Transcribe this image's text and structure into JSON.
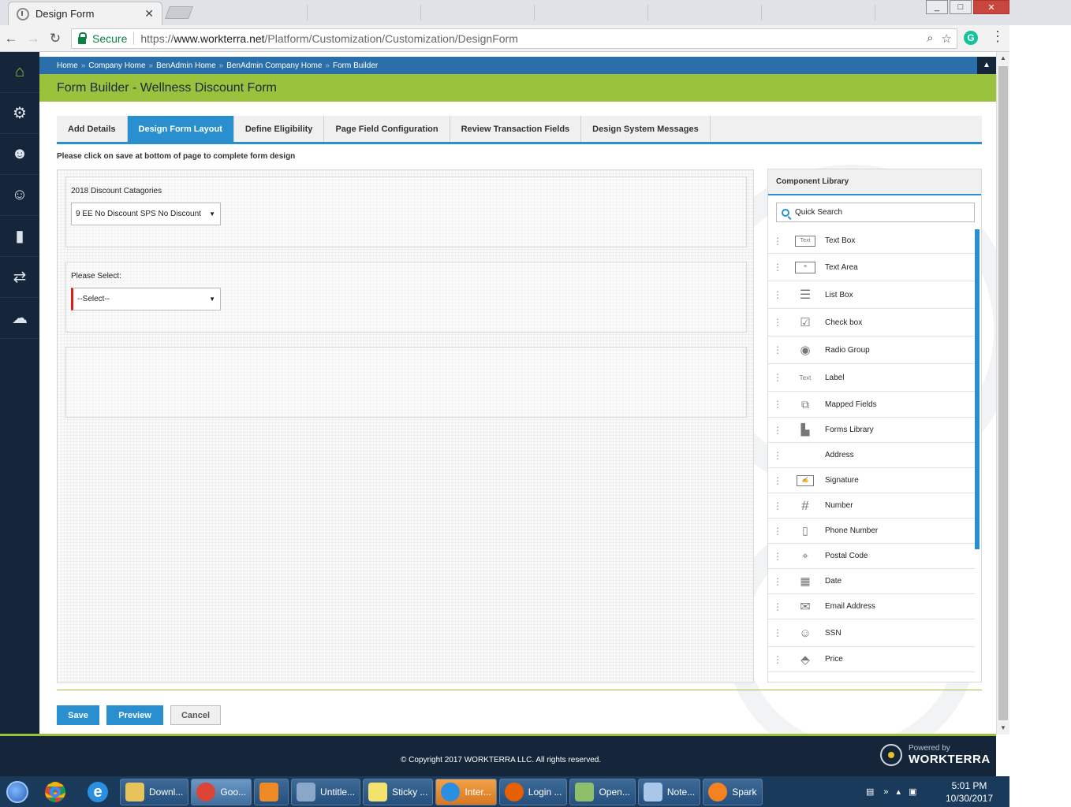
{
  "browser": {
    "tab_title": "Design Form",
    "tab_close": "✕",
    "secure_label": "Secure",
    "url_scheme": "https://",
    "url_host": "www.workterra.net",
    "url_path": "/Platform/Customization/Customization/DesignForm",
    "window_controls": {
      "minimize": "_",
      "maximize": "□",
      "close": "✕"
    }
  },
  "leftnav": {
    "items": [
      {
        "icon": "home-icon",
        "glyph": "⌂"
      },
      {
        "icon": "settings-icon",
        "glyph": "⚙"
      },
      {
        "icon": "user-settings-icon",
        "glyph": "☻"
      },
      {
        "icon": "user-icon",
        "glyph": "☺"
      },
      {
        "icon": "reports-icon",
        "glyph": "▮"
      },
      {
        "icon": "transfer-icon",
        "glyph": "⇄"
      },
      {
        "icon": "chat-icon",
        "glyph": "☁"
      }
    ]
  },
  "breadcrumb": {
    "items": [
      "Home",
      "Company Home",
      "BenAdmin Home",
      "BenAdmin Company Home",
      "Form Builder"
    ],
    "separator": "»"
  },
  "page": {
    "title": "Form Builder - Wellness Discount Form",
    "notice": "Please click on save at bottom of page to complete form design"
  },
  "tabs": [
    {
      "label": "Add Details",
      "active": false
    },
    {
      "label": "Design Form Layout",
      "active": true
    },
    {
      "label": "Define Eligibility",
      "active": false
    },
    {
      "label": "Page Field Configuration",
      "active": false
    },
    {
      "label": "Review Transaction Fields",
      "active": false
    },
    {
      "label": "Design System Messages",
      "active": false
    }
  ],
  "canvas": {
    "fields": [
      {
        "label": "2018 Discount Catagories",
        "value": "9 EE No Discount SPS No Discount",
        "required": false
      },
      {
        "label": "Please Select:",
        "value": "--Select--",
        "required": true
      }
    ]
  },
  "library": {
    "title": "Component Library",
    "search_placeholder": "Quick Search",
    "components": [
      {
        "label": "Text Box",
        "icon": "text-box-icon"
      },
      {
        "label": "Text Area",
        "icon": "text-area-icon"
      },
      {
        "label": "List Box",
        "icon": "list-box-icon"
      },
      {
        "label": "Check box",
        "icon": "check-box-icon"
      },
      {
        "label": "Radio Group",
        "icon": "radio-group-icon"
      },
      {
        "label": "Label",
        "icon": "label-icon"
      },
      {
        "label": "Mapped Fields",
        "icon": "mapped-fields-icon"
      },
      {
        "label": "Forms Library",
        "icon": "forms-library-icon"
      },
      {
        "label": "Address",
        "icon": "address-icon"
      },
      {
        "label": "Signature",
        "icon": "signature-icon"
      },
      {
        "label": "Number",
        "icon": "number-icon"
      },
      {
        "label": "Phone Number",
        "icon": "phone-number-icon"
      },
      {
        "label": "Postal Code",
        "icon": "postal-code-icon"
      },
      {
        "label": "Date",
        "icon": "date-icon"
      },
      {
        "label": "Email Address",
        "icon": "email-address-icon"
      },
      {
        "label": "SSN",
        "icon": "ssn-icon"
      },
      {
        "label": "Price",
        "icon": "price-icon"
      }
    ]
  },
  "actions": {
    "save": "Save",
    "preview": "Preview",
    "cancel": "Cancel"
  },
  "footer": {
    "copyright": "© Copyright 2017 WORKTERRA LLC. All rights reserved.",
    "powered_by": "Powered by",
    "brand": "WORKTERRA"
  },
  "taskbar": {
    "tasks": [
      {
        "label": "Downl...",
        "icon": "folder-icon",
        "color": "#e8c25a"
      },
      {
        "label": "Goo...",
        "icon": "chrome-icon",
        "color": "#db4437"
      },
      {
        "label": "",
        "icon": "media-icon",
        "color": "#f08a24"
      },
      {
        "label": "Untitle...",
        "icon": "paint-icon",
        "color": "#8aa6c9"
      },
      {
        "label": "Sticky ...",
        "icon": "sticky-notes-icon",
        "color": "#f3e26b"
      },
      {
        "label": "Inter...",
        "icon": "ie-icon",
        "color": "#2a8fe0"
      },
      {
        "label": "Login ...",
        "icon": "firefox-icon",
        "color": "#e66000"
      },
      {
        "label": "Open...",
        "icon": "calculator-icon",
        "color": "#8fbf6a"
      },
      {
        "label": "Note...",
        "icon": "notepad-icon",
        "color": "#a9c7e8"
      },
      {
        "label": "Spark",
        "icon": "spark-icon",
        "color": "#f58220"
      }
    ],
    "time": "5:01 PM",
    "date": "10/30/2017"
  }
}
